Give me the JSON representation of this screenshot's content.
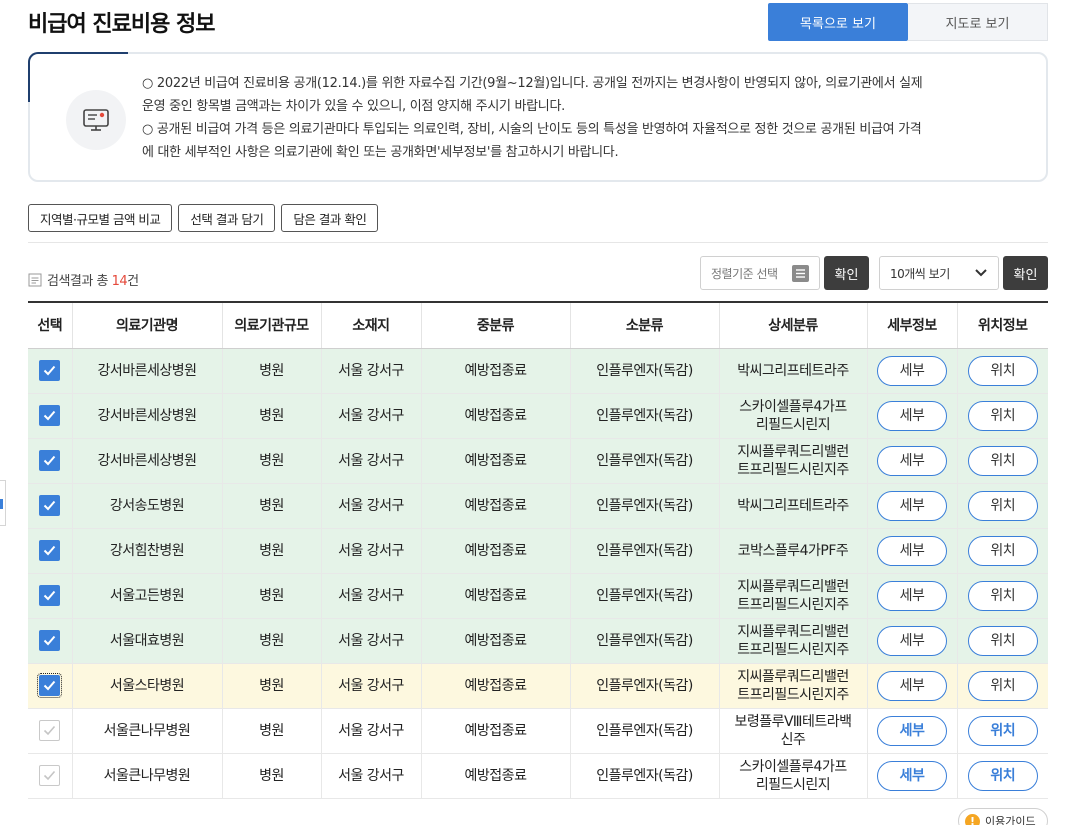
{
  "page_title": "비급여 진료비용 정보",
  "view_toggle": {
    "list_label": "목록으로 보기",
    "map_label": "지도로 보기"
  },
  "notice": {
    "line1": "○ 2022년 비급여 진료비용 공개(12.14.)를 위한 자료수집 기간(9월~12월)입니다. 공개일 전까지는 변경사항이 반영되지 않아, 의료기관에서 실제",
    "line2": "운영 중인 항목별 금액과는 차이가 있을 수 있으니, 이점 양지해 주시기 바랍니다.",
    "line3": "○ 공개된 비급여 가격 등은 의료기관마다 투입되는 의료인력, 장비, 시술의 난이도 등의 특성을 반영하여 자율적으로 정한 것으로 공개된 비급여 가격",
    "line4": "에 대한 세부적인 사항은 의료기관에 확인 또는 공개화면'세부정보'를 참고하시기 바랍니다."
  },
  "tool_buttons": {
    "compare": "지역별·규모별 금액 비교",
    "save": "선택 결과 담기",
    "saved": "담은 결과 확인"
  },
  "result": {
    "prefix": "검색결과 총 ",
    "count": "14",
    "suffix": "건"
  },
  "sort": {
    "placeholder": "정렬기준 선택",
    "confirm": "확인"
  },
  "page_size": {
    "value": "10개씩 보기",
    "confirm": "확인"
  },
  "columns": [
    "선택",
    "의료기관명",
    "의료기관규모",
    "소재지",
    "중분류",
    "소분류",
    "상세분류",
    "세부정보",
    "위치정보"
  ],
  "rows": [
    {
      "checked": true,
      "name": "강서바른세상병원",
      "scale": "병원",
      "location": "서울 강서구",
      "mid": "예방접종료",
      "sub": "인플루엔자(독감)",
      "detail": "박씨그리프테트라주",
      "detail_btn": "세부",
      "loc_btn": "위치"
    },
    {
      "checked": true,
      "name": "강서바른세상병원",
      "scale": "병원",
      "location": "서울 강서구",
      "mid": "예방접종료",
      "sub": "인플루엔자(독감)",
      "detail": "스카이셀플루4가프\n리필드시린지",
      "detail_btn": "세부",
      "loc_btn": "위치"
    },
    {
      "checked": true,
      "name": "강서바른세상병원",
      "scale": "병원",
      "location": "서울 강서구",
      "mid": "예방접종료",
      "sub": "인플루엔자(독감)",
      "detail": "지씨플루쿼드리밸런\n트프리필드시린지주",
      "detail_btn": "세부",
      "loc_btn": "위치"
    },
    {
      "checked": true,
      "name": "강서송도병원",
      "scale": "병원",
      "location": "서울 강서구",
      "mid": "예방접종료",
      "sub": "인플루엔자(독감)",
      "detail": "박씨그리프테트라주",
      "detail_btn": "세부",
      "loc_btn": "위치"
    },
    {
      "checked": true,
      "name": "강서힘찬병원",
      "scale": "병원",
      "location": "서울 강서구",
      "mid": "예방접종료",
      "sub": "인플루엔자(독감)",
      "detail": "코박스플루4가PF주",
      "detail_btn": "세부",
      "loc_btn": "위치"
    },
    {
      "checked": true,
      "name": "서울고든병원",
      "scale": "병원",
      "location": "서울 강서구",
      "mid": "예방접종료",
      "sub": "인플루엔자(독감)",
      "detail": "지씨플루쿼드리밸런\n트프리필드시린지주",
      "detail_btn": "세부",
      "loc_btn": "위치"
    },
    {
      "checked": true,
      "name": "서울대효병원",
      "scale": "병원",
      "location": "서울 강서구",
      "mid": "예방접종료",
      "sub": "인플루엔자(독감)",
      "detail": "지씨플루쿼드리밸런\n트프리필드시린지주",
      "detail_btn": "세부",
      "loc_btn": "위치"
    },
    {
      "checked": true,
      "name": "서울스타병원",
      "scale": "병원",
      "location": "서울 강서구",
      "mid": "예방접종료",
      "sub": "인플루엔자(독감)",
      "detail": "지씨플루쿼드리밸런\n트프리필드시린지주",
      "detail_btn": "세부",
      "loc_btn": "위치"
    },
    {
      "checked": false,
      "name": "서울큰나무병원",
      "scale": "병원",
      "location": "서울 강서구",
      "mid": "예방접종료",
      "sub": "인플루엔자(독감)",
      "detail": "보령플루Ⅷ테트라백\n신주",
      "detail_btn": "세부",
      "loc_btn": "위치"
    },
    {
      "checked": false,
      "name": "서울큰나무병원",
      "scale": "병원",
      "location": "서울 강서구",
      "mid": "예방접종료",
      "sub": "인플루엔자(독감)",
      "detail": "스카이셀플루4가프\n리필드시린지",
      "detail_btn": "세부",
      "loc_btn": "위치"
    }
  ],
  "guide_label": "이용가이드",
  "colors": {
    "primary": "#3a7fd9",
    "selected_row": "#e5f3e8",
    "hover_row": "#fdf8df",
    "count_red": "#e5493b",
    "dark_button": "#3d3d3d"
  }
}
